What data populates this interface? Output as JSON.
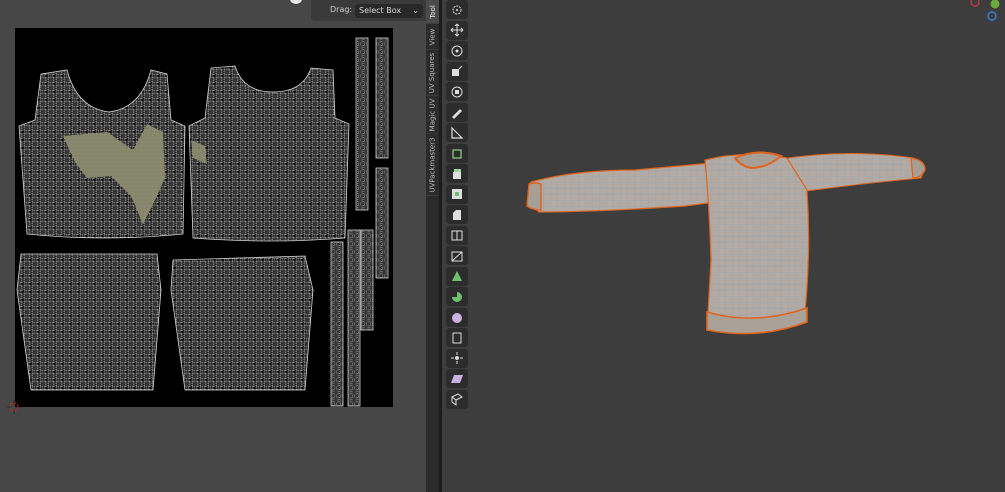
{
  "uv_header": {
    "drag_label": "Drag:",
    "select_mode": "Select Box"
  },
  "tabs": [
    "Tool",
    "View",
    "UV Squares",
    "Magic UV",
    "UVPackmaster3"
  ],
  "tools": [
    {
      "name": "cursor-icon",
      "active": false
    },
    {
      "name": "move-icon",
      "active": false
    },
    {
      "name": "rotate-icon",
      "active": false
    },
    {
      "name": "scale-icon",
      "active": false
    },
    {
      "name": "transform-icon",
      "active": false
    },
    {
      "name": "annotate-icon",
      "active": false
    },
    {
      "name": "measure-icon",
      "active": false
    },
    {
      "name": "add-cube-icon",
      "active": false
    },
    {
      "name": "extrude-icon",
      "active": false
    },
    {
      "name": "inset-icon",
      "active": false
    },
    {
      "name": "bevel-icon",
      "active": false
    },
    {
      "name": "loop-cut-icon",
      "active": false
    },
    {
      "name": "knife-icon",
      "active": false
    },
    {
      "name": "poly-build-icon",
      "active": false
    },
    {
      "name": "spin-icon",
      "active": false
    },
    {
      "name": "smooth-icon",
      "active": false
    },
    {
      "name": "edge-slide-icon",
      "active": false
    },
    {
      "name": "shrink-fatten-icon",
      "active": false
    },
    {
      "name": "shear-icon",
      "active": false
    },
    {
      "name": "rip-region-icon",
      "active": false
    }
  ],
  "colors": {
    "uv_background": "#000000",
    "uv_grid": "#c8c8c8",
    "uv_selected": "#8d8d70",
    "mesh_edge": "#e0641c",
    "mesh_wire": "#7f9dbb",
    "mesh_fill": "#b4aba1"
  }
}
